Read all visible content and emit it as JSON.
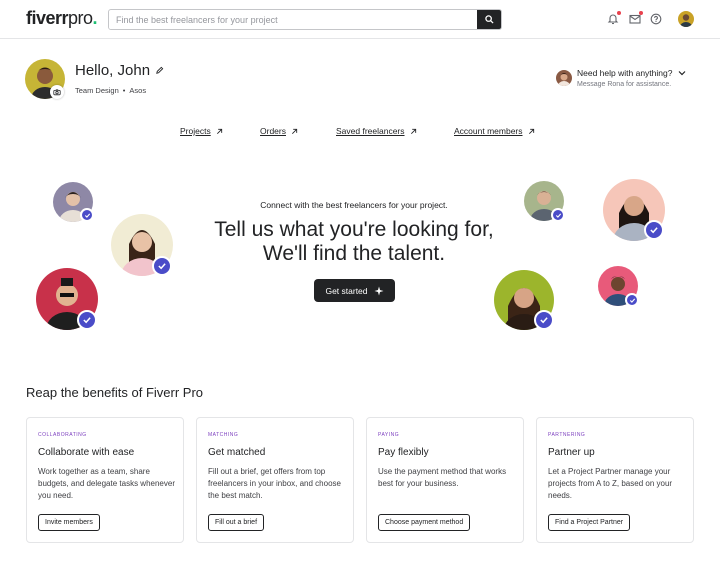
{
  "header": {
    "logo_main": "fiverr",
    "logo_pro": "pro",
    "logo_dot": ".",
    "search_placeholder": "Find the best freelancers for your project",
    "icons": [
      "bell-icon",
      "mail-icon",
      "help-icon"
    ]
  },
  "greeting": {
    "hello": "Hello, John",
    "team": "Team Design",
    "separator": "•",
    "company": "Asos"
  },
  "help": {
    "title": "Need help with anything?",
    "subtitle": "Message Rona for assistance."
  },
  "nav": {
    "links": [
      "Projects",
      "Orders",
      "Saved freelancers",
      "Account members"
    ]
  },
  "hero": {
    "subtitle": "Connect with the best freelancers for your project.",
    "title_line1": "Tell us what you're looking for,",
    "title_line2": "We'll find the talent.",
    "cta": "Get started"
  },
  "benefits": {
    "title": "Reap the benefits of Fiverr Pro",
    "cards": [
      {
        "kicker": "COLLABORATING",
        "title": "Collaborate with ease",
        "desc": "Work together as a team, share budgets, and delegate tasks whenever you need.",
        "button": "Invite members"
      },
      {
        "kicker": "MATCHING",
        "title": "Get matched",
        "desc": "Fill out a brief, get offers from top freelancers in your inbox, and choose the best match.",
        "button": "Fill out a brief"
      },
      {
        "kicker": "PAYING",
        "title": "Pay flexibly",
        "desc": "Use the payment method that works best for your business.",
        "button": "Choose payment method"
      },
      {
        "kicker": "PARTNERING",
        "title": "Partner up",
        "desc": "Let a Project Partner manage your projects from A to Z, based on your needs.",
        "button": "Find a Project Partner"
      }
    ]
  },
  "colors": {
    "accent_green": "#1dbf73",
    "kicker_purple": "#7c3fbf",
    "badge_blue": "#4a4cc8",
    "dark": "#222325"
  }
}
